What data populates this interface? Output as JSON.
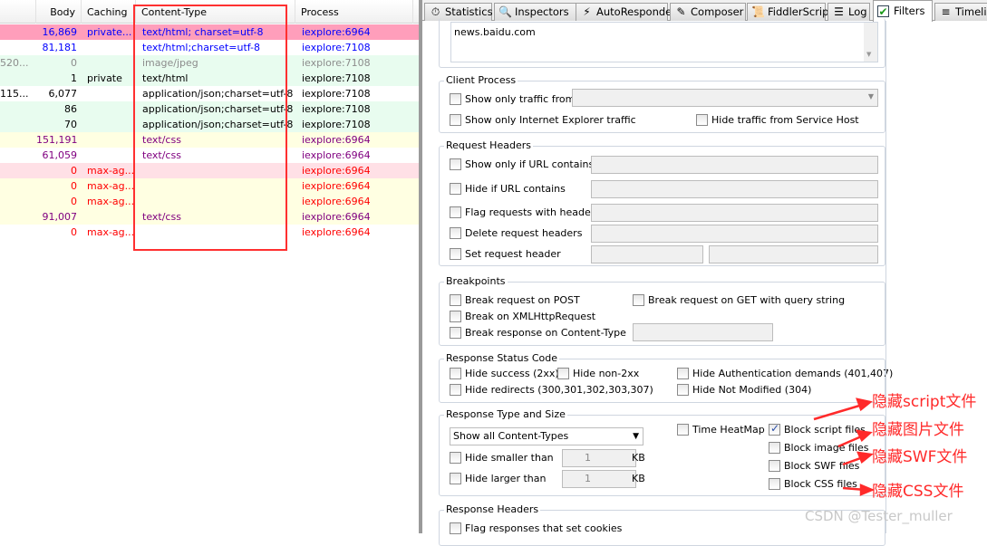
{
  "sessions": {
    "columns": [
      "Body",
      "Caching",
      "Content-Type",
      "Process"
    ],
    "rows": [
      {
        "first": "",
        "body": "16,869",
        "caching": "private...",
        "content_type": "text/html; charset=utf-8",
        "process": "iexplore:6964",
        "bg": "#ff9ebb",
        "fg": "#0000ff"
      },
      {
        "first": "",
        "body": "81,181",
        "caching": "",
        "content_type": "text/html;charset=utf-8",
        "process": "iexplore:7108",
        "bg": "#ffffff",
        "fg": "#0000ff"
      },
      {
        "first": "520...",
        "body": "0",
        "caching": "",
        "content_type": "image/jpeg",
        "process": "iexplore:7108",
        "bg": "#e8fcef",
        "fg": "#8c8c8c"
      },
      {
        "first": "",
        "body": "1",
        "caching": "private",
        "content_type": "text/html",
        "process": "iexplore:7108",
        "bg": "#e8fcef",
        "fg": "#000000"
      },
      {
        "first": "115...",
        "body": "6,077",
        "caching": "",
        "content_type": "application/json;charset=utf-8",
        "process": "iexplore:7108",
        "bg": "#ffffff",
        "fg": "#000000"
      },
      {
        "first": "",
        "body": "86",
        "caching": "",
        "content_type": "application/json;charset=utf-8",
        "process": "iexplore:7108",
        "bg": "#e8fcef",
        "fg": "#000000"
      },
      {
        "first": "",
        "body": "70",
        "caching": "",
        "content_type": "application/json;charset=utf-8",
        "process": "iexplore:7108",
        "bg": "#e8fcef",
        "fg": "#000000"
      },
      {
        "first": "",
        "body": "151,191",
        "caching": "",
        "content_type": "text/css",
        "process": "iexplore:6964",
        "bg": "#ffffe2",
        "fg": "#800080"
      },
      {
        "first": "",
        "body": "61,059",
        "caching": "",
        "content_type": "text/css",
        "process": "iexplore:6964",
        "bg": "#ffffff",
        "fg": "#800080"
      },
      {
        "first": "",
        "body": "0",
        "caching": "max-ag...",
        "content_type": "",
        "process": "iexplore:6964",
        "bg": "#ffe0e6",
        "fg": "#ff0000"
      },
      {
        "first": "",
        "body": "0",
        "caching": "max-ag...",
        "content_type": "",
        "process": "iexplore:6964",
        "bg": "#ffffe2",
        "fg": "#ff0000"
      },
      {
        "first": "",
        "body": "0",
        "caching": "max-ag...",
        "content_type": "",
        "process": "iexplore:6964",
        "bg": "#ffffe2",
        "fg": "#ff0000"
      },
      {
        "first": "",
        "body": "91,007",
        "caching": "",
        "content_type": "text/css",
        "process": "iexplore:6964",
        "bg": "#ffffe2",
        "fg": "#800080"
      },
      {
        "first": "",
        "body": "0",
        "caching": "max-ag...",
        "content_type": "",
        "process": "iexplore:6964",
        "bg": "#ffffff",
        "fg": "#ff0000"
      }
    ]
  },
  "tabs": [
    {
      "label": "Statistics",
      "icon": "stopwatch-icon"
    },
    {
      "label": "Inspectors",
      "icon": "magnifier-icon"
    },
    {
      "label": "AutoResponder",
      "icon": "lightning-icon"
    },
    {
      "label": "Composer",
      "icon": "pencil-icon"
    },
    {
      "label": "FiddlerScript",
      "icon": "script-icon"
    },
    {
      "label": "Log",
      "icon": "document-icon"
    },
    {
      "label": "Filters",
      "icon": "checkmark-icon",
      "active": true
    },
    {
      "label": "Timeline",
      "icon": "timeline-icon"
    }
  ],
  "filters": {
    "hosts_text": [
      "news.baidu.com"
    ],
    "client_process": {
      "title": "Client Process",
      "only_traffic_from": "Show only traffic from",
      "only_ie": "Show only Internet Explorer traffic",
      "hide_service_host": "Hide traffic from Service Host"
    },
    "request_headers": {
      "title": "Request Headers",
      "url_contains": "Show only if URL contains",
      "hide_url": "Hide if URL contains",
      "flag_headers": "Flag requests with headers",
      "delete_headers": "Delete request headers",
      "set_header": "Set request header"
    },
    "breakpoints": {
      "title": "Breakpoints",
      "post": "Break request on POST",
      "get_query": "Break request on GET with query string",
      "xhr": "Break on XMLHttpRequest",
      "content_type": "Break response on Content-Type"
    },
    "status_code": {
      "title": "Response Status Code",
      "success": "Hide success (2xx)",
      "non2xx": "Hide non-2xx",
      "auth": "Hide Authentication demands (401,407)",
      "redirects": "Hide redirects (300,301,302,303,307)",
      "not_modified": "Hide Not Modified (304)"
    },
    "type_size": {
      "title": "Response Type and Size",
      "select_value": "Show all Content-Types",
      "heatmap": "Time HeatMap",
      "smaller": "Hide smaller than",
      "larger": "Hide larger than",
      "smaller_value": "1",
      "larger_value": "1",
      "unit": "KB",
      "block_script": "Block script files",
      "block_script_checked": true,
      "block_image": "Block image files",
      "block_swf": "Block SWF files",
      "block_css": "Block CSS files"
    },
    "response_headers": {
      "title": "Response Headers",
      "flag_cookies": "Flag responses that set cookies"
    }
  },
  "annotations": [
    "隐藏script文件",
    "隐藏图片文件",
    "隐藏SWF文件",
    "隐藏CSS文件"
  ],
  "watermark": "CSDN @Tester_muller",
  "colors": {
    "highlight_box": "#ff3030",
    "annotation": "#ff2a2a"
  }
}
